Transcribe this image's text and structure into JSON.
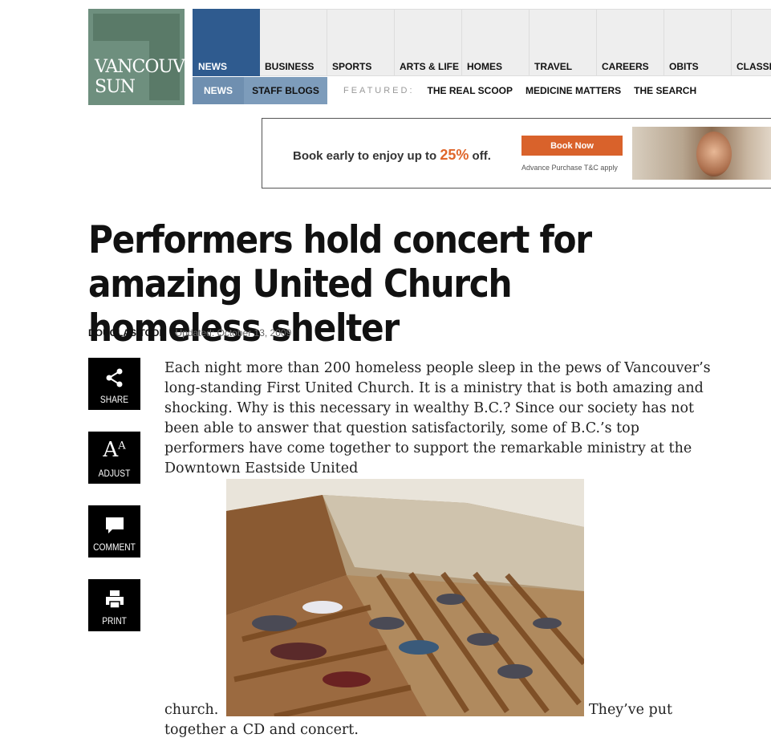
{
  "logo": {
    "line1": "VANCOUVER",
    "line2": "SUN"
  },
  "topnav": [
    "NEWS",
    "BUSINESS",
    "SPORTS",
    "ARTS & LIFE",
    "HOMES",
    "TRAVEL",
    "CAREERS",
    "OBITS",
    "CLASSI"
  ],
  "subnav": {
    "news": "NEWS",
    "blogs": "STAFF BLOGS",
    "featured_label": "FEATURED:",
    "links": [
      "THE REAL SCOOP",
      "MEDICINE MATTERS",
      "THE SEARCH"
    ]
  },
  "ad": {
    "text_before": "Book early to enjoy up to ",
    "percent": "25%",
    "text_after": " off.",
    "button": "Book Now",
    "fine_print": "Advance Purchase T&C apply"
  },
  "article": {
    "title": "Performers hold concert for amazing United Church homeless shelter",
    "author": "DOUGLAS TODD",
    "updated": "Updated: October 13, 2009",
    "body_part1": "Each night more than 200 homeless people sleep in the pews of Vancouver’s long-standing First United Church. It is a ministry that is both amazing and shocking. Why is this necessary in wealthy B.C.? Since our society has not been able to answer that question satisfactorily, some of B.C.’s top performers have come together to support the remarkable ministry at the Downtown Eastside United",
    "body_church": "church.",
    "body_after": "They’ve put",
    "body_last": "together a CD and concert."
  },
  "tools": {
    "share": "SHARE",
    "adjust": "ADJUST",
    "comment": "COMMENT",
    "print": "PRINT"
  },
  "colors": {
    "brand_green": "#6e8f7e",
    "nav_active": "#2f5b8f",
    "ad_accent": "#e0662b"
  }
}
